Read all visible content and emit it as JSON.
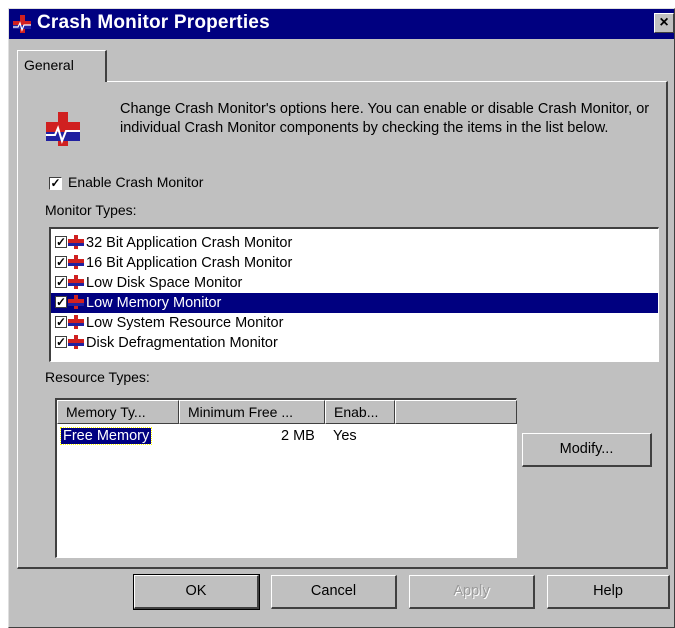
{
  "window": {
    "title": "Crash Monitor Properties",
    "close_glyph": "×"
  },
  "tabs": [
    {
      "label": "General",
      "active": true
    }
  ],
  "description": "Change Crash Monitor's options here. You can enable or disable Crash Monitor, or individual Crash Monitor components by checking the items in the list below.",
  "enable_checkbox": {
    "label": "Enable Crash Monitor",
    "checked": true,
    "glyph": "✓"
  },
  "monitor_types": {
    "label": "Monitor Types:",
    "items": [
      {
        "label": "32 Bit Application Crash Monitor",
        "checked": true,
        "selected": false
      },
      {
        "label": "16 Bit Application Crash Monitor",
        "checked": true,
        "selected": false
      },
      {
        "label": "Low Disk Space Monitor",
        "checked": true,
        "selected": false
      },
      {
        "label": "Low Memory Monitor",
        "checked": true,
        "selected": true
      },
      {
        "label": "Low System Resource Monitor",
        "checked": true,
        "selected": false
      },
      {
        "label": "Disk Defragmentation Monitor",
        "checked": true,
        "selected": false
      }
    ]
  },
  "resource_types": {
    "label": "Resource Types:",
    "columns": [
      "Memory Ty...",
      "Minimum Free ...",
      "Enab...",
      ""
    ],
    "rows": [
      {
        "type": "Free Memory",
        "minimum_free": "2 MB",
        "enabled": "Yes"
      }
    ]
  },
  "buttons": {
    "modify": "Modify...",
    "ok": "OK",
    "cancel": "Cancel",
    "apply": "Apply",
    "help": "Help"
  },
  "colors": {
    "face": "#c0c0c0",
    "titlebar": "#000080",
    "selection": "#000080",
    "icon_red": "#d02020",
    "icon_blue": "#2020a0"
  },
  "icons": {
    "app": "crash-monitor-icon"
  }
}
